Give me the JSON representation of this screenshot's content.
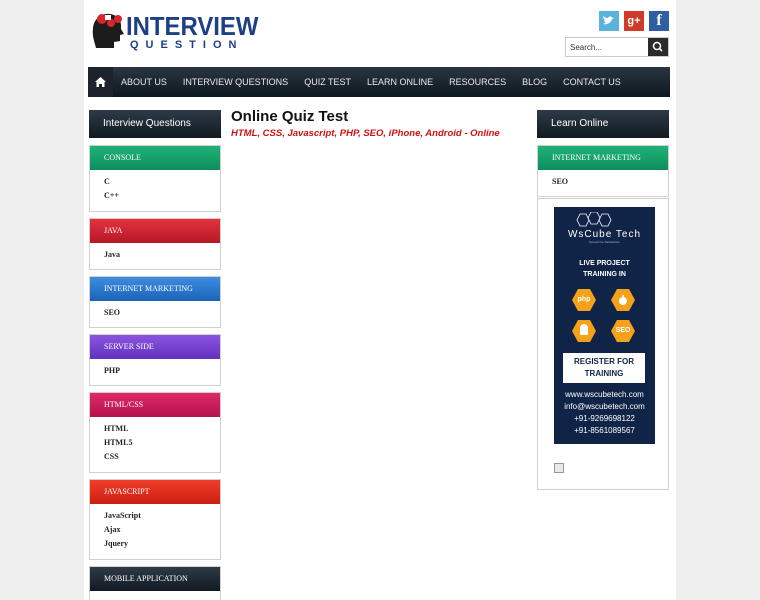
{
  "header": {
    "logo_title": "INTERVIEW",
    "logo_subtitle": "QUESTION",
    "social": [
      {
        "name": "twitter",
        "glyph": "t",
        "color": "#5bb2dd"
      },
      {
        "name": "google-plus",
        "glyph": "g+",
        "color": "#d03a2a"
      },
      {
        "name": "facebook",
        "glyph": "f",
        "color": "#2f5ea5"
      }
    ],
    "search_placeholder": "Search..."
  },
  "nav": {
    "items": [
      "ABOUT US",
      "INTERVIEW QUESTIONS",
      "QUIZ TEST",
      "LEARN ONLINE",
      "RESOURCES",
      "BLOG",
      "CONTACT US"
    ]
  },
  "left_sidebar": {
    "title": "Interview Questions",
    "categories": [
      {
        "title": "CONSOLE",
        "color": "#159e6a",
        "items": [
          "C",
          "C++"
        ]
      },
      {
        "title": "JAVA",
        "color": "#cf2232",
        "items": [
          "Java"
        ]
      },
      {
        "title": "INTERNET MARKETING",
        "color": "#2b77cf",
        "items": [
          "SEO"
        ]
      },
      {
        "title": "SERVER SIDE",
        "color": "#7642d0",
        "items": [
          "PHP"
        ]
      },
      {
        "title": "HTML/CSS",
        "color": "#c81a59",
        "items": [
          "HTML",
          "HTML5",
          "CSS"
        ]
      },
      {
        "title": "JAVASCRIPT",
        "color": "#de2d1e",
        "items": [
          "JavaScript",
          "Ajax",
          "Jquery"
        ]
      },
      {
        "title": "MOBILE APPLICATION",
        "color": "#1f2a35",
        "items": []
      }
    ]
  },
  "main": {
    "title": "Online Quiz Test",
    "subtitle": "HTML, CSS, Javascript, PHP, SEO, iPhone, Android - Online"
  },
  "right_sidebar": {
    "title": "Learn Online",
    "category": {
      "title": "INTERNET MARKETING",
      "items": [
        "SEO"
      ]
    },
    "ad": {
      "brand": "WsCube Tech",
      "tagline": "Spread the Satisfaction",
      "headline": "LIVE PROJECT TRAINING IN",
      "badges": [
        "php",
        "apple",
        "android",
        "SEO"
      ],
      "button": "REGISTER FOR TRAINING",
      "contact": [
        "www.wscubetech.com",
        "info@wscubetech.com",
        "+91-9269698122",
        "+91-8561089567"
      ]
    }
  }
}
